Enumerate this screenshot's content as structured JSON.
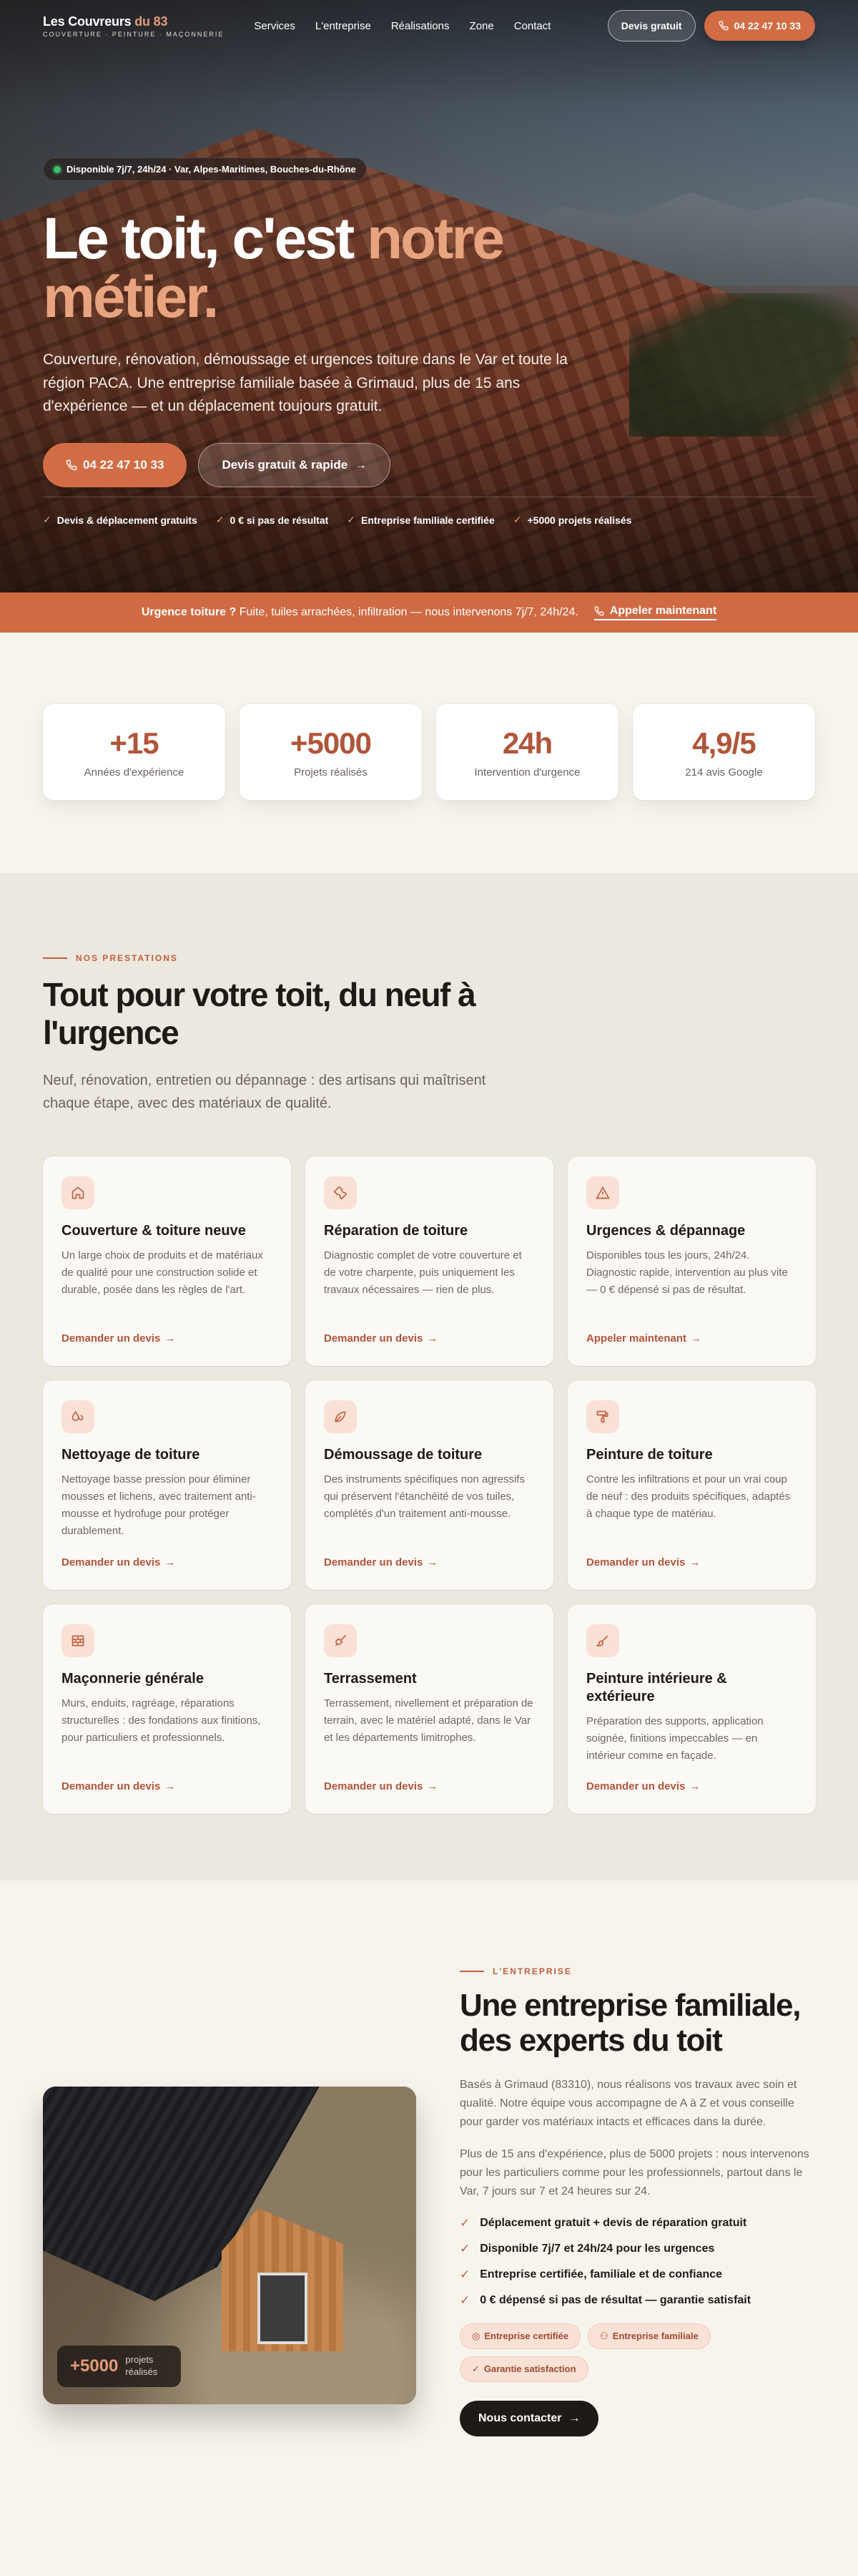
{
  "nav": {
    "brand_main": "Les Couvreurs",
    "brand_accent": "du 83",
    "tagline": "COUVERTURE · PEINTURE · MAÇONNERIE",
    "menu": [
      "Services",
      "L'entreprise",
      "Réalisations",
      "Zone",
      "Contact"
    ],
    "quote_btn": "Devis gratuit",
    "phone_btn": "04 22 47 10 33"
  },
  "hero": {
    "availability": "Disponible 7j/7, 24h/24 · Var, Alpes-Maritimes, Bouches-du-Rhône",
    "title_part1": "Le toit, c'est",
    "title_accent": "notre",
    "title_part2": "métier.",
    "lead": "Couverture, rénovation, démoussage et urgences toiture dans le Var et toute la région PACA. Une entreprise familiale basée à Grimaud, plus de 15 ans d'expérience — et un déplacement toujours gratuit.",
    "cta_phone": "04 22 47 10 33",
    "cta_quote": "Devis gratuit & rapide",
    "trust": [
      "Devis & déplacement gratuits",
      "0 € si pas de résultat",
      "Entreprise familiale certifiée",
      "+5000 projets réalisés"
    ]
  },
  "urgent": {
    "label": "Urgence toiture ?",
    "text": "Fuite, tuiles arrachées, infiltration — nous intervenons 7j/7, 24h/24.",
    "cta": "Appeler maintenant"
  },
  "stats": [
    {
      "value": "+15",
      "label": "Années d'expérience"
    },
    {
      "value": "+5000",
      "label": "Projets réalisés"
    },
    {
      "value": "24h",
      "label": "Intervention d'urgence"
    },
    {
      "value": "4,9/5",
      "label": "214 avis Google"
    }
  ],
  "services": {
    "eyebrow": "NOS PRESTATIONS",
    "title": "Tout pour votre toit, du neuf à l'urgence",
    "subtitle": "Neuf, rénovation, entretien ou dépannage : des artisans qui maîtrisent chaque étape, avec des matériaux de qualité.",
    "cards": [
      {
        "icon": "house-icon",
        "title": "Couverture & toiture neuve",
        "text": "Un large choix de produits et de matériaux de qualité pour une construction solide et durable, posée dans les règles de l'art.",
        "link": "Demander un devis"
      },
      {
        "icon": "wrench-icon",
        "title": "Réparation de toiture",
        "text": "Diagnostic complet de votre couverture et de votre charpente, puis uniquement les travaux nécessaires — rien de plus.",
        "link": "Demander un devis"
      },
      {
        "icon": "warning-icon",
        "title": "Urgences & dépannage",
        "text": "Disponibles tous les jours, 24h/24. Diagnostic rapide, intervention au plus vite — 0 € dépensé si pas de résultat.",
        "link": "Appeler maintenant"
      },
      {
        "icon": "droplets-icon",
        "title": "Nettoyage de toiture",
        "text": "Nettoyage basse pression pour éliminer mousses et lichens, avec traitement anti-mousse et hydrofuge pour protéger durablement.",
        "link": "Demander un devis"
      },
      {
        "icon": "leaf-icon",
        "title": "Démoussage de toiture",
        "text": "Des instruments spécifiques non agressifs qui préservent l'étanchéité de vos tuiles, complétés d'un traitement anti-mousse.",
        "link": "Demander un devis"
      },
      {
        "icon": "paint-roller-icon",
        "title": "Peinture de toiture",
        "text": "Contre les infiltrations et pour un vrai coup de neuf : des produits spécifiques, adaptés à chaque type de matériau.",
        "link": "Demander un devis"
      },
      {
        "icon": "bricks-icon",
        "title": "Maçonnerie générale",
        "text": "Murs, enduits, ragréage, réparations structurelles : des fondations aux finitions, pour particuliers et professionnels.",
        "link": "Demander un devis"
      },
      {
        "icon": "shovel-icon",
        "title": "Terrassement",
        "text": "Terrassement, nivellement et préparation de terrain, avec le matériel adapté, dans le Var et les départements limitrophes.",
        "link": "Demander un devis"
      },
      {
        "icon": "brush-icon",
        "title": "Peinture intérieure & extérieure",
        "text": "Préparation des supports, application soignée, finitions impeccables — en intérieur comme en façade.",
        "link": "Demander un devis"
      }
    ]
  },
  "about": {
    "eyebrow": "L'ENTREPRISE",
    "title": "Une entreprise familiale, des experts du toit",
    "p1": "Basés à Grimaud (83310), nous réalisons vos travaux avec soin et qualité. Notre équipe vous accompagne de A à Z et vous conseille pour garder vos matériaux intacts et efficaces dans la durée.",
    "p2": "Plus de 15 ans d'expérience, plus de 5000 projets : nous intervenons pour les particuliers comme pour les professionnels, partout dans le Var, 7 jours sur 7 et 24 heures sur 24.",
    "checks": [
      "Déplacement gratuit + devis de réparation gratuit",
      "Disponible 7j/7 et 24h/24 pour les urgences",
      "Entreprise certifiée, familiale et de confiance",
      "0 € dépensé si pas de résultat — garantie satisfait"
    ],
    "pills": [
      "Entreprise certifiée",
      "Entreprise familiale",
      "Garantie satisfaction"
    ],
    "badge_value": "+5000",
    "badge_label": "projets réalisés",
    "cta": "Nous contacter"
  },
  "colors": {
    "accent": "#cf6a43",
    "accent_dark": "#b1553a",
    "dark": "#1f1a17",
    "bg": "#f7f4ee"
  }
}
